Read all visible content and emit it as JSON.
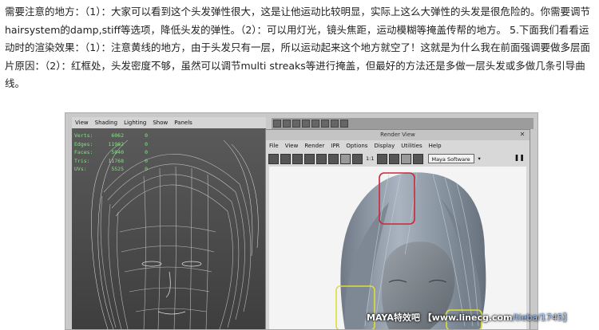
{
  "article": {
    "text": "需要注意的地方：（1）：大家可以看到这个头发弹性很大，这是让他运动比较明显，实际上这么大弹性的头发是很危险的。你需要调节hairsystem的damp,stiff等选项，降低头发的弹性。（2）：可以用灯光，镜头焦距，运动模糊等掩盖传帮的地方。 5.下面我们看看运动时的渲染效果：（1）：注意黄线的地方，由于头发只有一层，所以运动起来这个地方就空了！这就是为什么我在前面强调要做多层面片原因：（2）：红框处，头发密度不够，虽然可以调节multi streaks等进行掩盖，但最好的方法还是多做一层头发或多做几条引导曲线。"
  },
  "viewport": {
    "menu": [
      "View",
      "Shading",
      "Lighting",
      "Show",
      "Panels"
    ],
    "hud": [
      {
        "k": "Verts:",
        "v": "6062",
        "z": "0"
      },
      {
        "k": "Edges:",
        "v": "11902",
        "z": "0"
      },
      {
        "k": "Faces:",
        "v": "5040",
        "z": "0"
      },
      {
        "k": "Tris:",
        "v": "11768",
        "z": "0"
      },
      {
        "k": "UVs:",
        "v": "5525",
        "z": "0"
      }
    ]
  },
  "render_view": {
    "title": "Render View",
    "menu": [
      "File",
      "View",
      "Render",
      "IPR",
      "Options",
      "Display",
      "Utilities",
      "Help"
    ],
    "ratio_label": "1:1",
    "renderer": "Maya Software",
    "colors": {
      "red_box": "#c8283a",
      "yellow_box": "#dede3a"
    }
  },
  "watermark": {
    "main": "MAYA特效吧 【www.linecg.com",
    "tail": "/tieba/1745】"
  }
}
